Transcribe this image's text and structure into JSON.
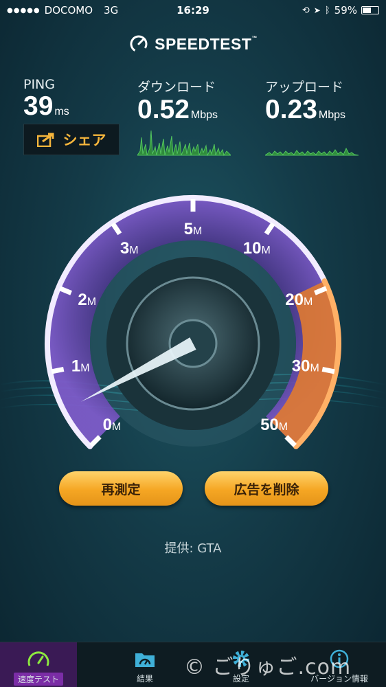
{
  "status_bar": {
    "signal": "●●●●●",
    "carrier": "DOCOMO",
    "network": "3G",
    "time": "16:29",
    "battery": "59%",
    "battery_level": 0.59
  },
  "header": {
    "title": "SPEEDTEST",
    "trademark": "™"
  },
  "metrics": {
    "ping": {
      "label": "PING",
      "value": "39",
      "unit": "ms"
    },
    "download": {
      "label": "ダウンロード",
      "value": "0.52",
      "unit": "Mbps"
    },
    "upload": {
      "label": "アップロード",
      "value": "0.23",
      "unit": "Mbps"
    }
  },
  "share_button": {
    "label": "シェア"
  },
  "gauge": {
    "ticks": [
      {
        "num": "0",
        "unit": "M"
      },
      {
        "num": "1",
        "unit": "M"
      },
      {
        "num": "2",
        "unit": "M"
      },
      {
        "num": "3",
        "unit": "M"
      },
      {
        "num": "5",
        "unit": "M"
      },
      {
        "num": "10",
        "unit": "M"
      },
      {
        "num": "20",
        "unit": "M"
      },
      {
        "num": "30",
        "unit": "M"
      },
      {
        "num": "50",
        "unit": "M"
      }
    ],
    "needle_value_mbps": 0.52
  },
  "buttons": {
    "retest": "再測定",
    "remove_ads": "広告を削除"
  },
  "provider": {
    "text": "提供: GTA"
  },
  "tabs": [
    {
      "label": "速度テスト",
      "icon": "speedometer-icon",
      "active": true
    },
    {
      "label": "結果",
      "icon": "results-folder-icon",
      "active": false
    },
    {
      "label": "設定",
      "icon": "gear-icon",
      "active": false
    },
    {
      "label": "バージョン情報",
      "icon": "info-icon",
      "active": false
    }
  ],
  "watermark": "© ごりゅご.com",
  "colors": {
    "accent_orange": "#f5a623",
    "gauge_purple": "#8a5ed6",
    "sparkline_green": "#3fb04a",
    "share_text": "#f5b53c"
  }
}
